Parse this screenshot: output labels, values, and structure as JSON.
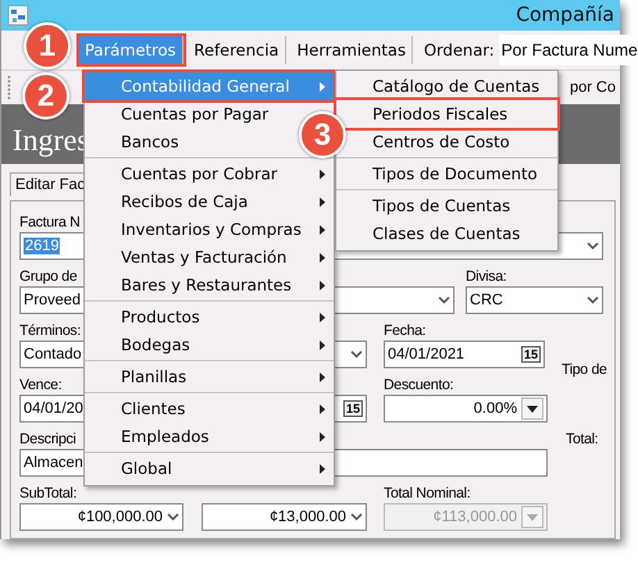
{
  "window": {
    "title": "Compañía"
  },
  "menu_bar": {
    "items": [
      {
        "label": "Parámetros",
        "selected": true,
        "outlined": true
      },
      {
        "label": "Referencia",
        "selected": false,
        "outlined": false
      },
      {
        "label": "Herramientas",
        "selected": false,
        "outlined": false
      }
    ],
    "sort_label": "Ordenar:",
    "sort_value": "Por Factura Nume"
  },
  "toolbar": {
    "text": "por Co"
  },
  "header": {
    "title": "Ingres"
  },
  "form": {
    "tab": "Editar Fac",
    "rows": [
      [
        {
          "kind": "label",
          "text": "Factura N"
        }
      ],
      [
        {
          "kind": "text",
          "value": "2619",
          "highlighted": true
        },
        {
          "kind": "combo"
        }
      ],
      [
        {
          "kind": "label",
          "text": "Grupo de"
        },
        {
          "kind": "label",
          "text": "Divisa:"
        }
      ],
      [
        {
          "kind": "combo",
          "value": "Proveed"
        },
        {
          "kind": "combo",
          "value": "CRC"
        }
      ],
      [
        {
          "kind": "label",
          "text": "Términos:"
        },
        {
          "kind": "label",
          "text": "Fecha:"
        }
      ],
      [
        {
          "kind": "combo",
          "value": "Contado"
        },
        {
          "kind": "date",
          "value": "04/01/2021",
          "icon_text": "15"
        },
        {
          "kind": "label",
          "text": "Tipo de"
        }
      ],
      [
        {
          "kind": "label",
          "text": "Vence:"
        },
        {
          "kind": "label",
          "text": "Descuento:"
        }
      ],
      [
        {
          "kind": "date",
          "value": "04/01/20",
          "icon_text": "15"
        },
        {
          "kind": "spin",
          "value": "0.00%",
          "disabled": false
        }
      ],
      [
        {
          "kind": "label",
          "text": "Descripci"
        },
        {
          "kind": "label",
          "text": "Total:"
        }
      ],
      [
        {
          "kind": "text",
          "value": "Almacen",
          "highlighted": false
        }
      ],
      [
        {
          "kind": "label",
          "text": "SubTotal:"
        },
        {
          "kind": "label",
          "text": "Total Nominal:"
        }
      ],
      [
        {
          "kind": "combo",
          "value": "¢100,000.00"
        },
        {
          "kind": "combo",
          "value": "¢13,000.00"
        },
        {
          "kind": "spin",
          "value": "¢113,000.00",
          "disabled": true
        }
      ]
    ]
  },
  "menu": {
    "items": [
      {
        "kind": "item",
        "label": "Contabilidad General",
        "submenu": true,
        "selected": true,
        "outlined": true
      },
      {
        "kind": "item",
        "label": "Cuentas por Pagar",
        "submenu": false,
        "selected": false,
        "outlined": false
      },
      {
        "kind": "item",
        "label": "Bancos",
        "submenu": false,
        "selected": false,
        "outlined": false
      },
      {
        "kind": "separator"
      },
      {
        "kind": "item",
        "label": "Cuentas por Cobrar",
        "submenu": true,
        "selected": false,
        "outlined": false
      },
      {
        "kind": "item",
        "label": "Recibos de Caja",
        "submenu": true,
        "selected": false,
        "outlined": false
      },
      {
        "kind": "item",
        "label": "Inventarios y Compras",
        "submenu": true,
        "selected": false,
        "outlined": false
      },
      {
        "kind": "item",
        "label": "Ventas y Facturación",
        "submenu": true,
        "selected": false,
        "outlined": false
      },
      {
        "kind": "item",
        "label": "Bares y Restaurantes",
        "submenu": true,
        "selected": false,
        "outlined": false
      },
      {
        "kind": "separator"
      },
      {
        "kind": "item",
        "label": "Productos",
        "submenu": true,
        "selected": false,
        "outlined": false
      },
      {
        "kind": "item",
        "label": "Bodegas",
        "submenu": true,
        "selected": false,
        "outlined": false
      },
      {
        "kind": "separator"
      },
      {
        "kind": "item",
        "label": "Planillas",
        "submenu": true,
        "selected": false,
        "outlined": false
      },
      {
        "kind": "separator"
      },
      {
        "kind": "item",
        "label": "Clientes",
        "submenu": true,
        "selected": false,
        "outlined": false
      },
      {
        "kind": "item",
        "label": "Empleados",
        "submenu": true,
        "selected": false,
        "outlined": false
      },
      {
        "kind": "separator"
      },
      {
        "kind": "item",
        "label": "Global",
        "submenu": true,
        "selected": false,
        "outlined": false
      }
    ]
  },
  "submenu": {
    "items": [
      {
        "kind": "item",
        "label": "Catálogo de Cuentas",
        "submenu": false,
        "selected": false,
        "outlined": false
      },
      {
        "kind": "item",
        "label": "Periodos Fiscales",
        "submenu": false,
        "selected": false,
        "outlined": true
      },
      {
        "kind": "item",
        "label": "Centros de Costo",
        "submenu": false,
        "selected": false,
        "outlined": false
      },
      {
        "kind": "separator"
      },
      {
        "kind": "item",
        "label": "Tipos de Documento",
        "submenu": false,
        "selected": false,
        "outlined": false
      },
      {
        "kind": "separator"
      },
      {
        "kind": "item",
        "label": "Tipos de Cuentas",
        "submenu": false,
        "selected": false,
        "outlined": false
      },
      {
        "kind": "item",
        "label": "Clases de Cuentas",
        "submenu": false,
        "selected": false,
        "outlined": false
      }
    ]
  },
  "callouts": [
    "1",
    "2",
    "3"
  ]
}
